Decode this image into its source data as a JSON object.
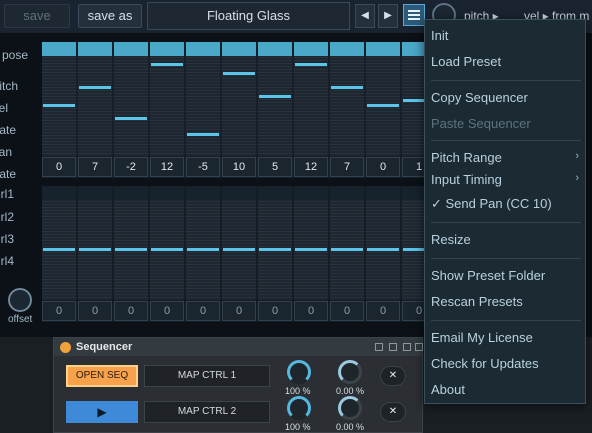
{
  "toolbar": {
    "save_label": "save",
    "save_as_label": "save as",
    "preset_name": "Floating Glass",
    "prev_arrow": "◀",
    "next_arrow": "▶",
    "pitch_label": "pitch ▸",
    "vel_label": "vel ▸ from m"
  },
  "left_labels": [
    "pose",
    "itch",
    "el",
    "ate",
    "an",
    "ate",
    "rl1",
    "rl2",
    "rl3",
    "rl4"
  ],
  "offset_label": "offset",
  "sequencer": {
    "accent_color": "#59c6ea",
    "top_values": [
      "0",
      "7",
      "-2",
      "12",
      "-5",
      "10",
      "5",
      "12",
      "7",
      "0",
      "1"
    ],
    "top_levels": [
      0.5,
      0.7,
      0.36,
      0.95,
      0.18,
      0.85,
      0.6,
      0.95,
      0.7,
      0.5,
      0.55
    ],
    "bottom_values": [
      "0",
      "0",
      "0",
      "0",
      "0",
      "0",
      "0",
      "0",
      "0",
      "0",
      "0"
    ],
    "bottom_levels": [
      0.5,
      0.5,
      0.5,
      0.5,
      0.5,
      0.5,
      0.5,
      0.5,
      0.5,
      0.5,
      0.5
    ]
  },
  "device": {
    "title": "Sequencer",
    "open_seq_label": "OPEN SEQ",
    "play_symbol": "▶",
    "map1_label": "MAP CTRL 1",
    "map2_label": "MAP CTRL 2",
    "dial1_value": "100 %",
    "dial2_value": "0.00 %",
    "dial3_value": "100 %",
    "dial4_value": "0.00 %",
    "close_label": "✕"
  },
  "menu": {
    "items": [
      {
        "label": "Init"
      },
      {
        "label": "Load Preset"
      },
      {
        "label": "Copy Sequencer"
      },
      {
        "label": "Paste Sequencer",
        "disabled": true
      },
      {
        "label": "Pitch Range",
        "submenu": true
      },
      {
        "label": "Input Timing",
        "submenu": true
      },
      {
        "label": "✓ Send Pan (CC 10)"
      },
      {
        "label": "Resize"
      },
      {
        "label": "Show Preset Folder"
      },
      {
        "label": "Rescan Presets"
      },
      {
        "label": "Email My License"
      },
      {
        "label": "Check for Updates"
      },
      {
        "label": "About"
      }
    ],
    "chevron": "›"
  }
}
